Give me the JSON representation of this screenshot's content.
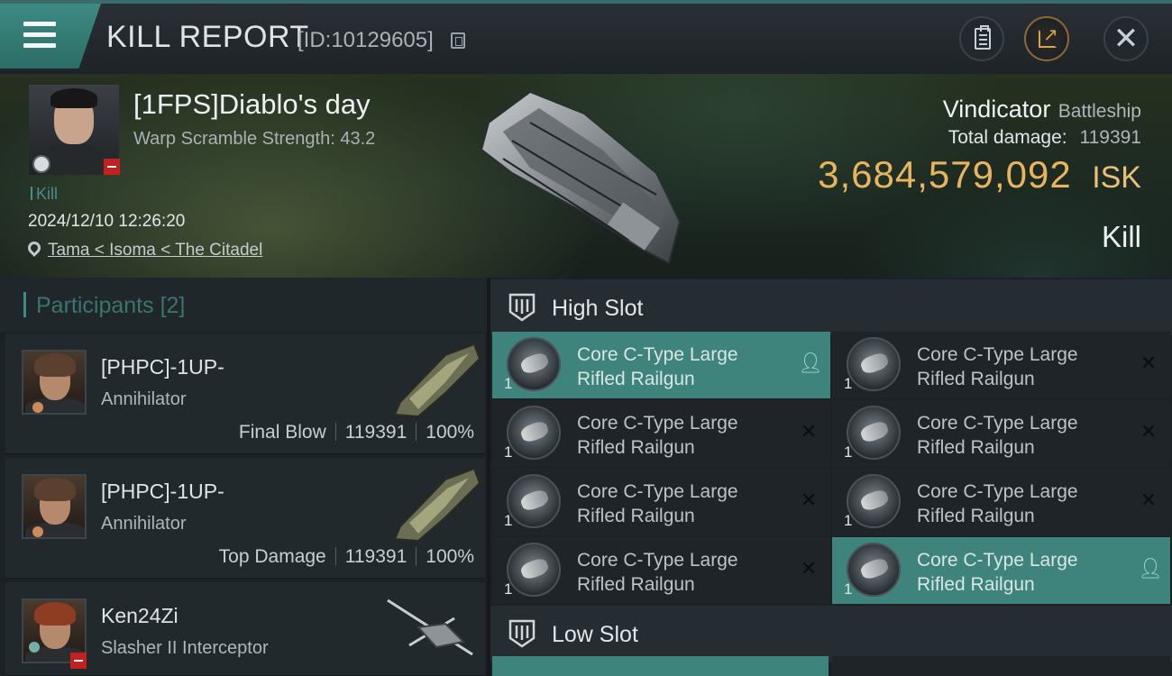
{
  "header": {
    "title": "KILL REPORT",
    "report_id": "[ID:10129605]",
    "buttons": [
      "clipboard-icon",
      "share-icon",
      "close-icon"
    ]
  },
  "victim": {
    "name": "[1FPS]Diablo's day",
    "warp_scramble": "Warp Scramble Strength: 43.2",
    "tag": "Kill",
    "datetime": "2024/12/10 12:26:20",
    "location": "Tama < Isoma < The Citadel",
    "ship_name": "Vindicator",
    "ship_class": "Battleship",
    "total_damage_label": "Total damage:",
    "total_damage": "119391",
    "isk_value": "3,684,579,092",
    "isk_unit": "ISK",
    "result": "Kill"
  },
  "participants": {
    "title": "Participants",
    "count": "[2]",
    "rows": [
      {
        "name": "[PHPC]-1UP-",
        "ship": "Annihilator",
        "role": "Final Blow",
        "damage": "119391",
        "percent": "100%"
      },
      {
        "name": "[PHPC]-1UP-",
        "ship": "Annihilator",
        "role": "Top Damage",
        "damage": "119391",
        "percent": "100%"
      },
      {
        "name": "Ken24Zi",
        "ship": "Slasher II Interceptor"
      }
    ]
  },
  "high_slot": {
    "title": "High Slot",
    "modules": [
      {
        "qty": "1",
        "line1": "Core C-Type Large",
        "line2": "Rifled Railgun",
        "status": "dropped",
        "status_icon": "person-icon"
      },
      {
        "qty": "1",
        "line1": "Core C-Type Large",
        "line2": "Rifled Railgun",
        "status": "destroyed",
        "status_icon": "x-icon"
      },
      {
        "qty": "1",
        "line1": "Core C-Type Large",
        "line2": "Rifled Railgun",
        "status": "destroyed",
        "status_icon": "x-icon"
      },
      {
        "qty": "1",
        "line1": "Core C-Type Large",
        "line2": "Rifled Railgun",
        "status": "destroyed",
        "status_icon": "x-icon"
      },
      {
        "qty": "1",
        "line1": "Core C-Type Large",
        "line2": "Rifled Railgun",
        "status": "destroyed",
        "status_icon": "x-icon"
      },
      {
        "qty": "1",
        "line1": "Core C-Type Large",
        "line2": "Rifled Railgun",
        "status": "destroyed",
        "status_icon": "x-icon"
      },
      {
        "qty": "1",
        "line1": "Core C-Type Large",
        "line2": "Rifled Railgun",
        "status": "destroyed",
        "status_icon": "x-icon"
      },
      {
        "qty": "1",
        "line1": "Core C-Type Large",
        "line2": "Rifled Railgun",
        "status": "dropped",
        "status_icon": "person-icon"
      }
    ]
  },
  "low_slot": {
    "title": "Low Slot"
  },
  "colors": {
    "accent_teal": "#3e837c",
    "isk_gold": "#e8b55e",
    "loss_red": "#c32020"
  }
}
